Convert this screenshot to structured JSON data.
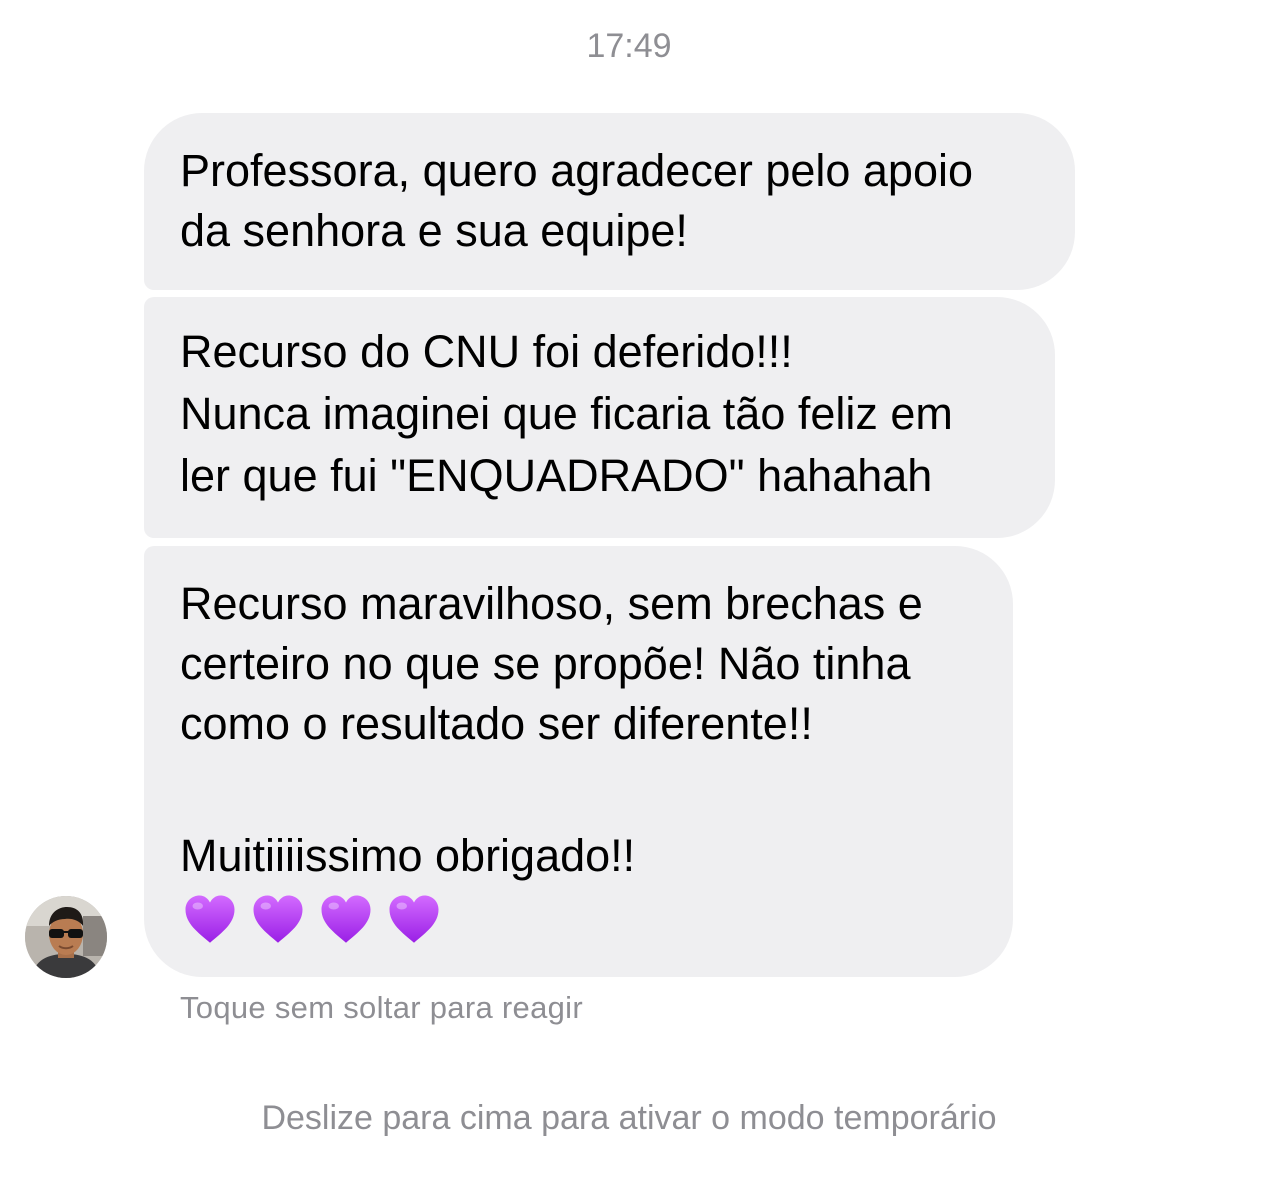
{
  "chat": {
    "timestamp": "17:49",
    "messages": [
      {
        "lines": [
          "Professora, quero agradecer pelo apoio",
          "da senhora e sua equipe!"
        ]
      },
      {
        "lines": [
          "Recurso do CNU foi deferido!!!",
          "Nunca imaginei que ficaria tão feliz em",
          "ler que fui \"ENQUADRADO\" hahahah"
        ]
      },
      {
        "lines": [
          "Recurso maravilhoso, sem brechas e",
          "certeiro no que se propõe! Não tinha",
          "como o resultado ser diferente!!",
          "Muitiiiissimo obrigado!!"
        ],
        "emoji": "purple-heart",
        "emoji_count": 4
      }
    ],
    "reaction_hint": "Toque sem soltar para reagir",
    "footer_hint": "Deslize para cima para ativar o modo temporário"
  },
  "colors": {
    "bubble_background": "#efeff1",
    "secondary_text": "#8e8e93",
    "heart": "#b23cf0"
  }
}
